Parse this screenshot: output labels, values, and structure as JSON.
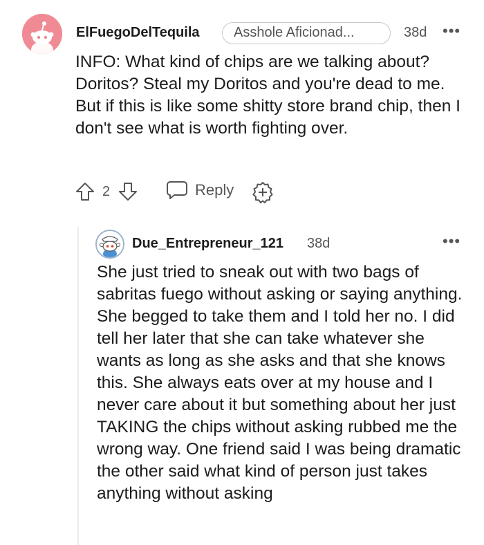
{
  "comment": {
    "username": "ElFuegoDelTequila",
    "flair": "Asshole Aficionad...",
    "age": "38d",
    "more": "•••",
    "body": "INFO: What kind of chips are we talking about? Doritos? Steal my Doritos and you're dead to me. But if this is like some shitty store brand chip, then I don't see what is worth fighting over.",
    "score": "2",
    "reply_label": "Reply",
    "colors": {
      "avatar_bg": "#f08a95",
      "text": "#1c1c1c",
      "meta": "#555555"
    }
  },
  "reply": {
    "username": "Due_Entrepreneur_121",
    "age": "38d",
    "more": "•••",
    "body": "She just tried to sneak out with two bags of sabritas fuego without asking or saying anything. She begged to take them and I told her no. I did tell her later that she can take whatever she wants as long as she asks and that she knows this. She always eats over at my house and I never care about it but something about her just TAKING the chips without asking rubbed me the wrong way. One friend said I was being dramatic the other said what kind of person just takes anything without asking"
  }
}
